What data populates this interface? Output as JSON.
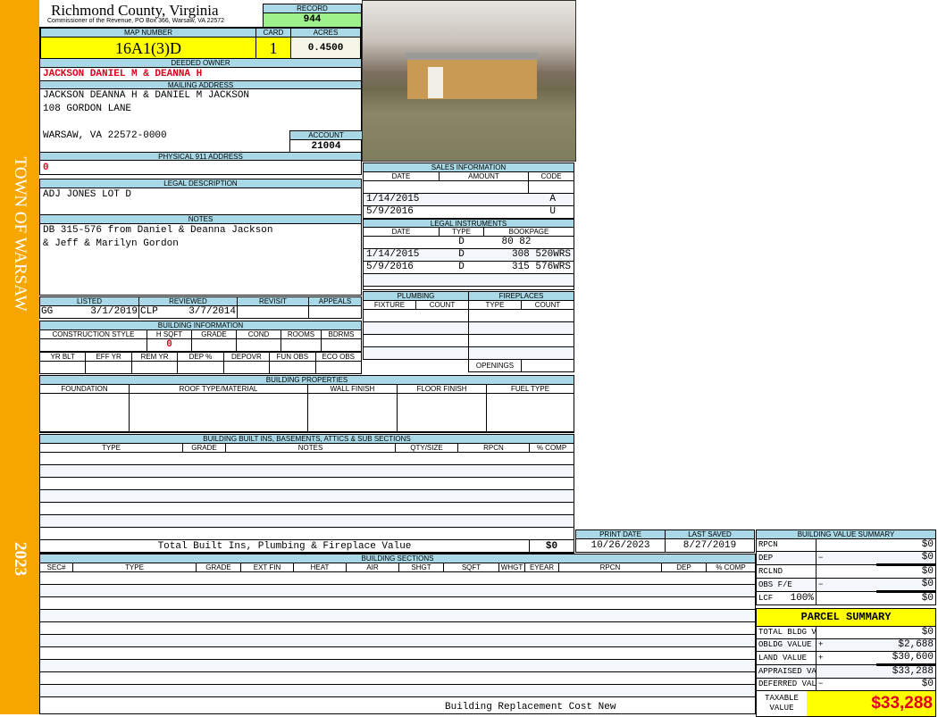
{
  "side": {
    "town": "TOWN OF WARSAW",
    "year": "2023"
  },
  "header": {
    "title": "Richmond County, Virginia",
    "subtitle": "Commissioner of the Revenue, PO Box 366, Warsaw, VA 22572",
    "record_label": "RECORD",
    "record": "944"
  },
  "parcel": {
    "map_label": "MAP NUMBER",
    "map": "16A1(3)D",
    "card_label": "CARD",
    "card": "1",
    "acres_label": "ACRES",
    "acres": "0.4500"
  },
  "owner": {
    "label": "DEEDED OWNER",
    "value": "JACKSON DANIEL M & DEANNA H"
  },
  "mailing": {
    "label": "MAILING ADDRESS",
    "line1": "JACKSON DEANNA H & DANIEL M JACKSON",
    "line2": "108 GORDON LANE",
    "line3": "WARSAW, VA 22572-0000",
    "account_label": "ACCOUNT",
    "account": "21004"
  },
  "physical": {
    "label": "PHYSICAL 911 ADDRESS",
    "value": "0"
  },
  "legal": {
    "label": "LEGAL DESCRIPTION",
    "value": "ADJ JONES LOT D"
  },
  "notes": {
    "label": "NOTES",
    "line1": "DB 315-576 from Daniel & Deanna Jackson",
    "line2": "& Jeff & Marilyn Gordon"
  },
  "listing": {
    "headers": [
      "LISTED",
      "REVIEWED",
      "REVISIT",
      "APPEALS"
    ],
    "listed_by": "GG",
    "listed_date": "3/1/2019",
    "reviewed_by": "CLP",
    "reviewed_date": "3/7/2014"
  },
  "building_info": {
    "label": "BUILDING INFORMATION",
    "headers1": [
      "CONSTRUCTION STYLE",
      "H SQFT",
      "GRADE",
      "COND",
      "ROOMS",
      "BDRMS"
    ],
    "hsqft": "0",
    "headers2": [
      "YR BLT",
      "EFF YR",
      "REM YR",
      "DEP %",
      "DEPOVR",
      "FUN OBS",
      "ECO OBS"
    ]
  },
  "sales": {
    "label": "SALES INFORMATION",
    "headers": [
      "DATE",
      "AMOUNT",
      "CODE"
    ],
    "rows": [
      {
        "date": "",
        "amount": "",
        "code": ""
      },
      {
        "date": "1/14/2015",
        "amount": "",
        "code": "A"
      },
      {
        "date": "5/9/2016",
        "amount": "",
        "code": "U"
      }
    ]
  },
  "instruments": {
    "label": "LEGAL INSTRUMENTS",
    "headers": [
      "DATE",
      "TYPE",
      "BOOKPAGE"
    ],
    "rows": [
      {
        "date": "",
        "type": "D",
        "book": "80 82"
      },
      {
        "date": "1/14/2015",
        "type": "D",
        "book": "308 520WRS"
      },
      {
        "date": "5/9/2016",
        "type": "D",
        "book": "315 576WRS"
      }
    ]
  },
  "plumbing": {
    "label": "PLUMBING",
    "headers": [
      "FIXTURE",
      "COUNT"
    ]
  },
  "fireplaces": {
    "label": "FIREPLACES",
    "headers": [
      "TYPE",
      "COUNT"
    ],
    "openings": "OPENINGS"
  },
  "properties": {
    "label": "BUILDING PROPERTIES",
    "headers": [
      "FOUNDATION",
      "ROOF TYPE/MATERIAL",
      "WALL FINISH",
      "FLOOR FINISH",
      "FUEL TYPE"
    ]
  },
  "builtins": {
    "label": "BUILDING BUILT INS, BASEMENTS, ATTICS & SUB SECTIONS",
    "headers": [
      "TYPE",
      "GRADE",
      "NOTES",
      "QTY/SIZE",
      "RPCN",
      "% COMP"
    ],
    "total_label": "Total Built Ins, Plumbing & Fireplace Value",
    "total": "$0"
  },
  "dates": {
    "print_label": "PRINT DATE",
    "print": "10/26/2023",
    "saved_label": "LAST SAVED",
    "saved": "8/27/2019"
  },
  "sections": {
    "label": "BUILDING SECTIONS",
    "headers": [
      "SEC#",
      "TYPE",
      "GRADE",
      "EXT FIN",
      "HEAT",
      "AIR",
      "SHGT",
      "SQFT",
      "WHGT",
      "EYEAR",
      "RPCN",
      "DEP",
      "% COMP"
    ],
    "footer": "Building Replacement Cost New"
  },
  "value_summary": {
    "label": "BUILDING VALUE SUMMARY",
    "rows": [
      {
        "label": "RPCN",
        "extra": "",
        "op": "",
        "value": "$0"
      },
      {
        "label": "DEP",
        "extra": "",
        "op": "−",
        "value": "$0"
      },
      {
        "label": "RCLND",
        "extra": "",
        "op": "",
        "value": "$0"
      },
      {
        "label": "OBS F/E",
        "extra": "",
        "op": "−",
        "value": "$0"
      },
      {
        "label": "LCF",
        "extra": "100%",
        "op": "",
        "value": "$0"
      }
    ]
  },
  "parcel_summary": {
    "label": "PARCEL SUMMARY",
    "rows": [
      {
        "label": "TOTAL BLDG VALUE",
        "op": "",
        "value": "$0"
      },
      {
        "label": "OBLDG VALUE",
        "op": "+",
        "value": "$2,688"
      },
      {
        "label": "LAND VALUE",
        "op": "+",
        "value": "$30,600"
      },
      {
        "label": "APPRAISED VALUE",
        "op": "",
        "value": "$33,288"
      },
      {
        "label": "DEFERRED VALUE",
        "op": "−",
        "value": "$0"
      }
    ],
    "taxable_label": "TAXABLE VALUE",
    "taxable": "$33,288"
  },
  "colors": {
    "side": "#f7a600",
    "header": "#a9d9e6",
    "yellow": "#ffff00",
    "green": "#9ef08a",
    "red": "#e0001b"
  }
}
